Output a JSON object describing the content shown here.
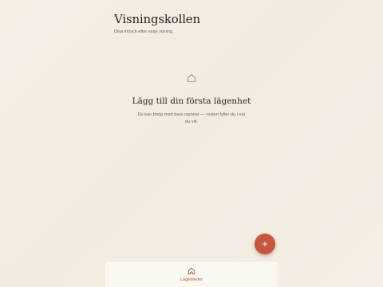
{
  "header": {
    "title": "Visningskollen",
    "subtitle": "Dina intryck efter varje visning"
  },
  "empty_state": {
    "icon": "house-icon",
    "title": "Lägg till din första lägenhet",
    "text": "Du kan börja med bara namnet — resten fyller du i när du vill."
  },
  "fab": {
    "icon": "plus-icon",
    "symbol": "+"
  },
  "bottom_nav": {
    "items": [
      {
        "label": "Lägenheter",
        "icon": "house-icon",
        "active": true
      }
    ]
  },
  "colors": {
    "background": "#f4eee4",
    "accent": "#c4583e",
    "text": "#2a2521",
    "muted": "#6e655c",
    "nav_background": "#fbf8f2"
  }
}
